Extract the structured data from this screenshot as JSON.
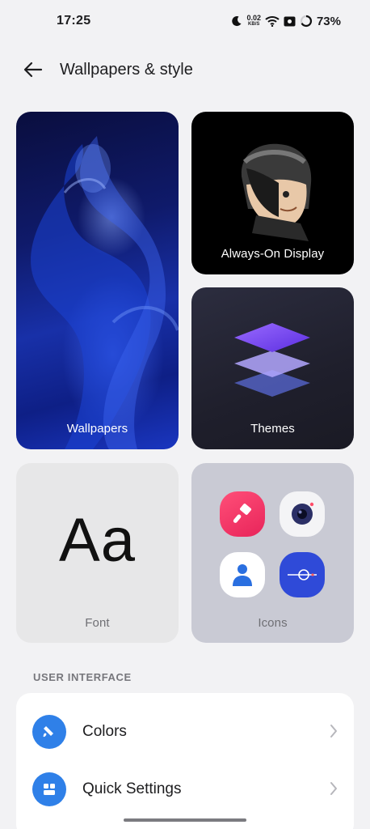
{
  "status_bar": {
    "time": "17:25",
    "net_speed_value": "0.02",
    "net_speed_unit": "KB/S",
    "battery": "73%",
    "icons": [
      "moon-icon",
      "wifi-icon",
      "screenshot-notification-icon",
      "battery-ring-icon"
    ]
  },
  "header": {
    "title": "Wallpapers & style",
    "back_icon": "back-arrow-icon"
  },
  "tiles": {
    "wallpapers": {
      "label": "Wallpapers"
    },
    "aod": {
      "label": "Always-On Display"
    },
    "themes": {
      "label": "Themes"
    },
    "font": {
      "label": "Font",
      "sample": "Aa"
    },
    "icons": {
      "label": "Icons",
      "preview": [
        "paintbrush-icon",
        "camera-icon",
        "contacts-icon",
        "compass-icon"
      ]
    }
  },
  "sections": {
    "user_interface": {
      "title": "USER INTERFACE",
      "items": [
        {
          "label": "Colors",
          "icon": "paint-icon"
        },
        {
          "label": "Quick Settings",
          "icon": "quick-settings-icon"
        }
      ]
    }
  },
  "colors": {
    "accent": "#2f80e8",
    "background": "#f2f2f4"
  }
}
